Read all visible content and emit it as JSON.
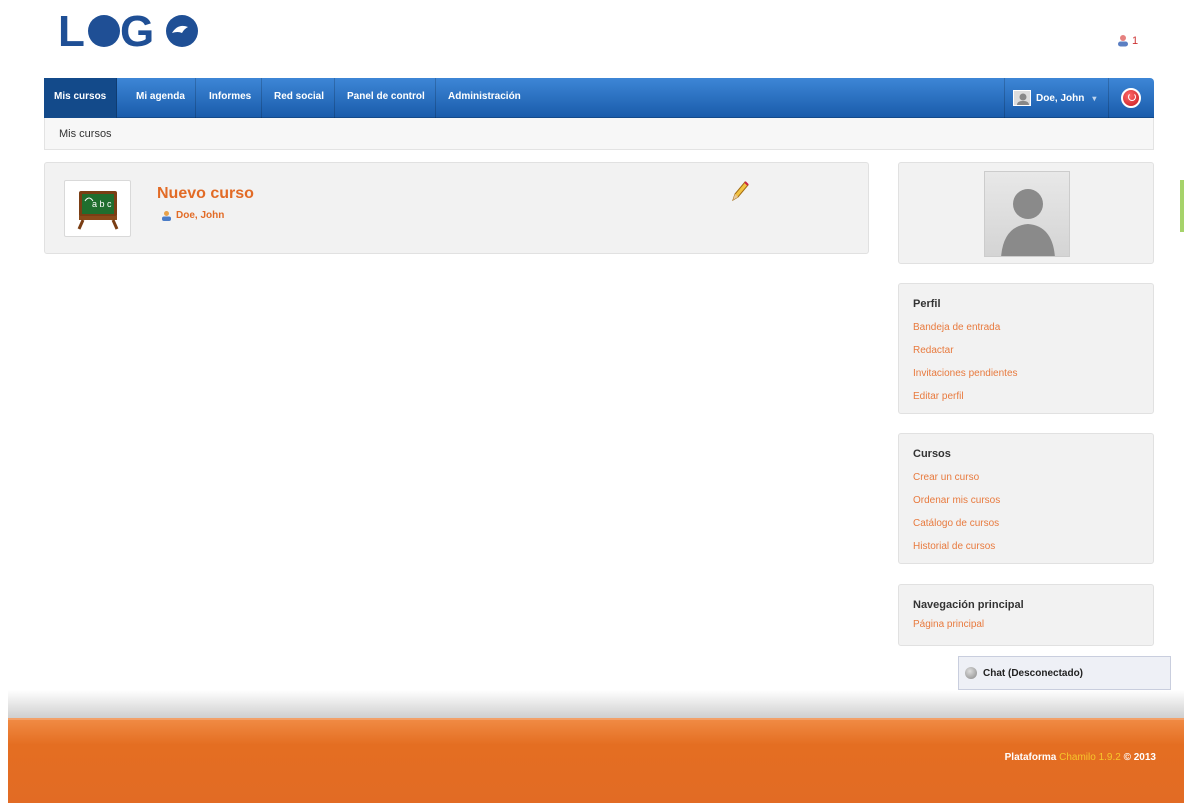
{
  "header": {
    "logo_text": "LOGO",
    "notification_count": "1"
  },
  "nav": {
    "items": [
      {
        "label": "Mis cursos",
        "active": true
      },
      {
        "label": "Mi agenda",
        "active": false
      },
      {
        "label": "Informes",
        "active": false
      },
      {
        "label": "Red social",
        "active": false
      },
      {
        "label": "Panel de control",
        "active": false
      },
      {
        "label": "Administración",
        "active": false
      }
    ],
    "user_label": "Doe, John",
    "user_icon": "avatar-icon",
    "logout_icon": "power-icon",
    "brand_color": "#1a5cab"
  },
  "breadcrumb": {
    "current": "Mis cursos"
  },
  "course": {
    "title": "Nuevo curso",
    "teacher": "Doe, John",
    "thumb_icon": "blackboard-icon",
    "edit_icon": "pencil-icon"
  },
  "sidebar": {
    "perfil": {
      "title": "Perfil",
      "links": [
        "Bandeja de entrada",
        "Redactar",
        "Invitaciones pendientes",
        "Editar perfil"
      ]
    },
    "cursos": {
      "title": "Cursos",
      "links": [
        "Crear un curso",
        "Ordenar mis cursos",
        "Catálogo de cursos",
        "Historial de cursos"
      ]
    },
    "navegacion": {
      "title": "Navegación principal",
      "links": [
        "Página principal"
      ]
    }
  },
  "chat": {
    "label": "Chat (Desconectado)"
  },
  "footer": {
    "prefix": "Plataforma",
    "brand": "Chamilo 1.9.2",
    "suffix": "© 2013",
    "accent": "#e26b24"
  }
}
